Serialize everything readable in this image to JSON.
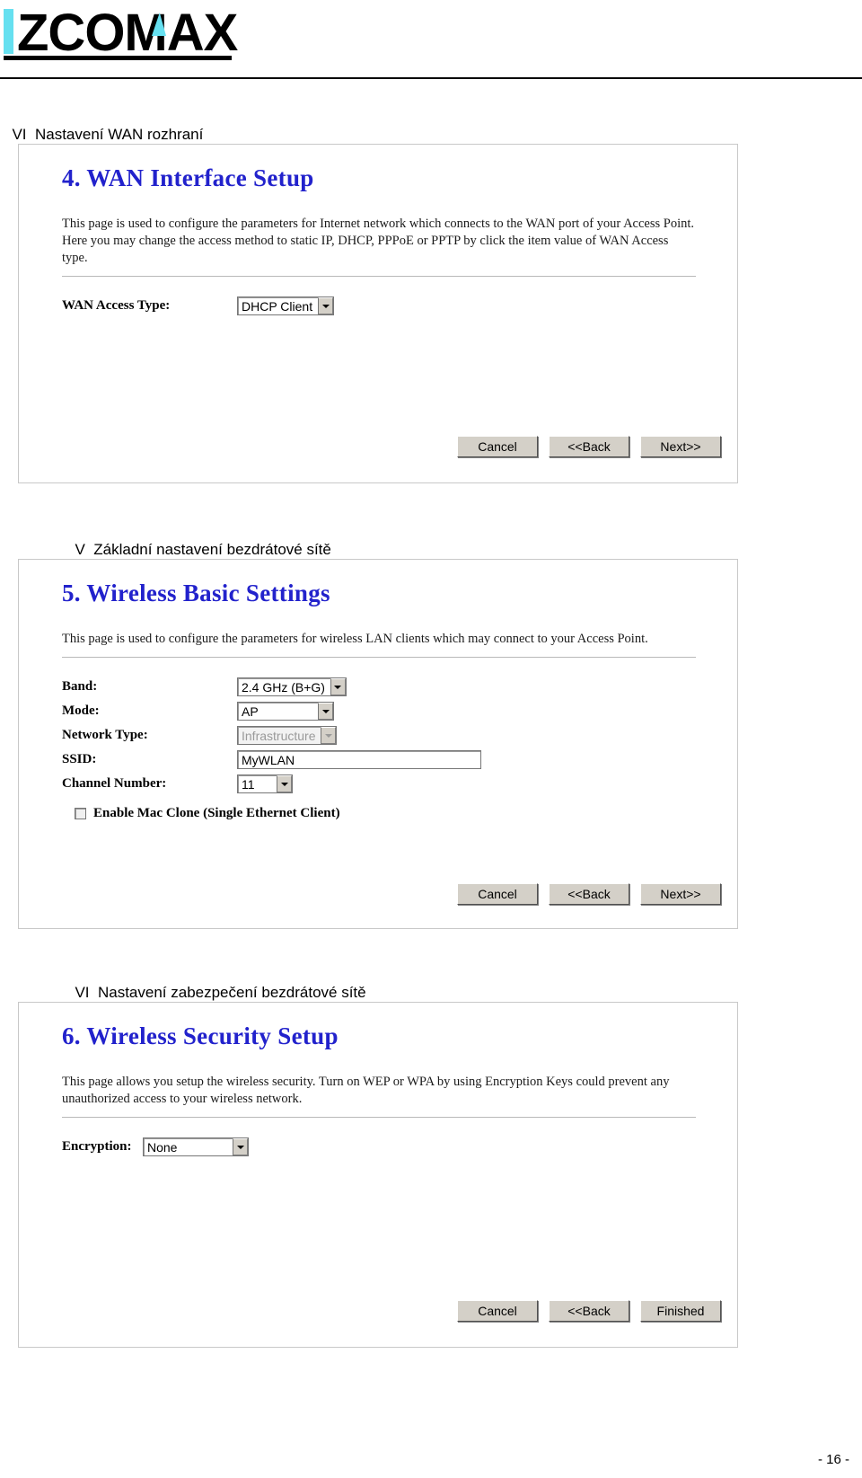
{
  "header": {
    "logo_text": "ZCOMAX",
    "logo_bar_color": "#66e0f0",
    "logo_accent_color": "#66e0f0",
    "logo_text_color": "#000000"
  },
  "sections": [
    {
      "number": "VI",
      "title": "Nastavení WAN rozhraní"
    },
    {
      "number": "V",
      "title": "Základní nastavení bezdrátové sítě"
    },
    {
      "number": "VI",
      "title": "Nastavení zabezpečení bezdrátové sítě"
    }
  ],
  "panel_wan": {
    "title": "4. WAN Interface Setup",
    "description": "This page is used to configure the parameters for Internet network which connects to the WAN port of your Access Point. Here you may change the access method to static IP, DHCP, PPPoE or PPTP by click the item value of WAN Access type.",
    "fields": [
      {
        "label": "WAN Access Type:",
        "value": "DHCP Client",
        "control": "select"
      }
    ],
    "buttons": [
      "Cancel",
      "<<Back",
      "Next>>"
    ]
  },
  "panel_wireless_basic": {
    "title": "5. Wireless Basic Settings",
    "description": "This page is used to configure the parameters for wireless LAN clients which may connect to your Access Point.",
    "fields": [
      {
        "label": "Band:",
        "value": "2.4 GHz (B+G)",
        "control": "select"
      },
      {
        "label": "Mode:",
        "value": "AP",
        "control": "select"
      },
      {
        "label": "Network Type:",
        "value": "Infrastructure",
        "control": "select-disabled"
      },
      {
        "label": "SSID:",
        "value": "MyWLAN",
        "control": "text"
      },
      {
        "label": "Channel Number:",
        "value": "11",
        "control": "select"
      }
    ],
    "checkbox": {
      "label": "Enable Mac Clone (Single Ethernet Client)",
      "checked": false
    },
    "buttons": [
      "Cancel",
      "<<Back",
      "Next>>"
    ]
  },
  "panel_wireless_security": {
    "title": "6. Wireless Security Setup",
    "description": "This page allows you setup the wireless security. Turn on WEP or WPA by using Encryption Keys could prevent any unauthorized access to your wireless network.",
    "fields": [
      {
        "label": "Encryption:",
        "value": "None",
        "control": "select"
      }
    ],
    "buttons": [
      "Cancel",
      "<<Back",
      "Finished"
    ]
  },
  "footer": {
    "page_number": "- 16 -"
  }
}
